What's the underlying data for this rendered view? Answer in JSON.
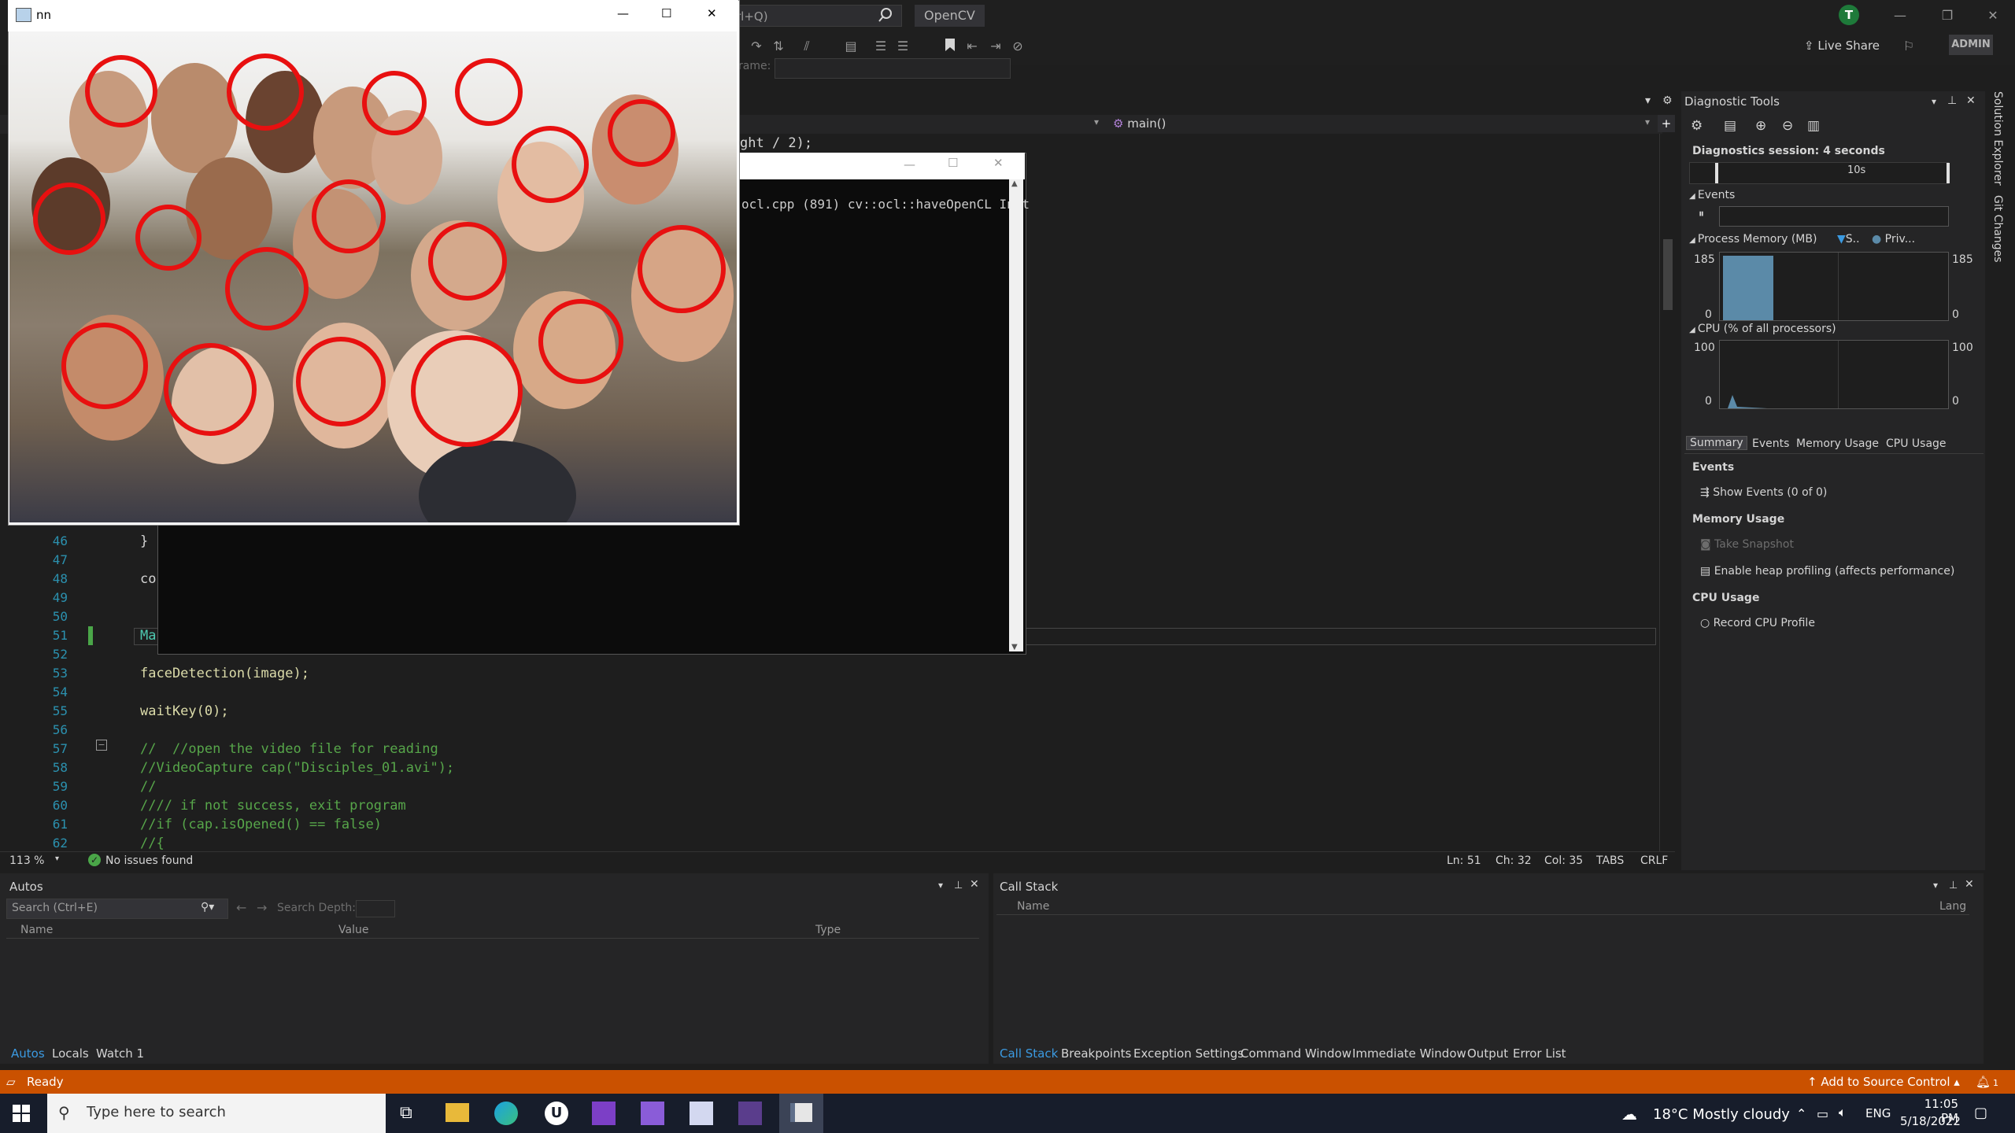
{
  "titlebar": {
    "search_placeholder": "rl+Q)",
    "solution_name": "OpenCV",
    "user_initial": "T",
    "minimize": "—",
    "restore": "❐",
    "close": "✕"
  },
  "toolbar": {
    "live_share": "Live Share",
    "admin_badge": "ADMIN",
    "frame_label": "rame:"
  },
  "editor": {
    "nav_function": "main()",
    "partial_code_top": "ght / 2);",
    "lines": [
      {
        "n": "46",
        "code": "}"
      },
      {
        "n": "47",
        "code": ""
      },
      {
        "n": "48",
        "code": "co"
      },
      {
        "n": "49",
        "code": ""
      },
      {
        "n": "50",
        "code": ""
      },
      {
        "n": "51",
        "code": "Ma"
      },
      {
        "n": "52",
        "code": ""
      },
      {
        "n": "53",
        "code": "faceDetection(image);"
      },
      {
        "n": "54",
        "code": ""
      },
      {
        "n": "55",
        "code": "waitKey(0);"
      },
      {
        "n": "56",
        "code": ""
      },
      {
        "n": "57",
        "code": "//  //open the video file for reading"
      },
      {
        "n": "58",
        "code": "//VideoCapture cap(\"Disciples_01.avi\");"
      },
      {
        "n": "59",
        "code": "//"
      },
      {
        "n": "60",
        "code": "//// if not success, exit program"
      },
      {
        "n": "61",
        "code": "//if (cap.isOpened() == false)"
      },
      {
        "n": "62",
        "code": "//{"
      }
    ],
    "zoom": "113 %",
    "issues": "No issues found",
    "ln": "Ln: 51",
    "ch": "Ch: 32",
    "col": "Col: 35",
    "tabs": "TABS",
    "crlf": "CRLF"
  },
  "diagnostics": {
    "title": "Diagnostic Tools",
    "session": "Diagnostics session: 4 seconds",
    "timeline_label": "10s",
    "events_header": "Events",
    "memory_header": "Process Memory (MB)",
    "memory_legend_1": "S..",
    "memory_legend_2": "Priv...",
    "mem_max_left": "185",
    "mem_min_left": "0",
    "mem_max_right": "185",
    "mem_min_right": "0",
    "cpu_header": "CPU (% of all processors)",
    "cpu_max_left": "100",
    "cpu_min_left": "0",
    "cpu_max_right": "100",
    "cpu_min_right": "0",
    "tabs": [
      "Summary",
      "Events",
      "Memory Usage",
      "CPU Usage"
    ],
    "section_events": "Events",
    "show_events": "Show Events (0 of 0)",
    "section_memory": "Memory Usage",
    "take_snapshot": "Take Snapshot",
    "enable_heap": "Enable heap profiling (affects performance)",
    "section_cpu": "CPU Usage",
    "record_cpu": "Record CPU Profile",
    "memory_level": 0.95,
    "cpu_spike": 0.2
  },
  "right_rail": {
    "solution_explorer": "Solution Explorer",
    "git_changes": "Git Changes"
  },
  "autos": {
    "title": "Autos",
    "search_placeholder": "Search (Ctrl+E)",
    "search_depth": "Search Depth:",
    "col_name": "Name",
    "col_value": "Value",
    "col_type": "Type",
    "tabs": [
      "Autos",
      "Locals",
      "Watch 1"
    ]
  },
  "callstack": {
    "title": "Call Stack",
    "col_name": "Name",
    "col_lang": "Lang",
    "tabs": [
      "Call Stack",
      "Breakpoints",
      "Exception Settings",
      "Command Window",
      "Immediate Window",
      "Output",
      "Error List"
    ]
  },
  "statusbar": {
    "ready": "Ready",
    "source_control": "Add to Source Control",
    "notif_count": "1"
  },
  "taskbar": {
    "search_placeholder": "Type here to search",
    "weather": "18°C  Mostly cloudy",
    "lang": "ENG",
    "time": "11:05 PM",
    "date": "5/18/2022"
  },
  "image_window": {
    "title": "nn",
    "minimize": "—",
    "maximize": "☐",
    "close": "✕"
  },
  "console": {
    "output": "ocl.cpp (891) cv::ocl::haveOpenCL Init"
  },
  "colors": {
    "accent": "#007acc",
    "statusbar": "#ca5100",
    "face_circle": "#e81010",
    "chart_fill": "#5b8aa8"
  }
}
